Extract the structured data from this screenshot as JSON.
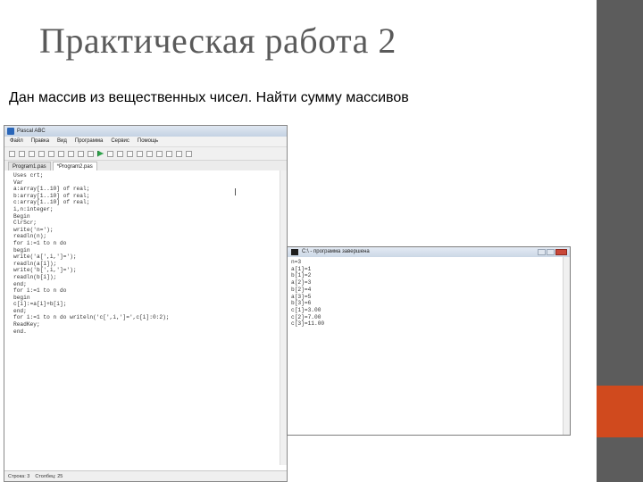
{
  "slide": {
    "title": "Практическая работа 2",
    "subtitle": "Дан массив из вещественных чисел. Найти сумму массивов"
  },
  "ide": {
    "window_title": "Pascal ABC",
    "menu": [
      "Файл",
      "Правка",
      "Вид",
      "Программа",
      "Сервис",
      "Помощь"
    ],
    "tabs": [
      "Program1.pas",
      "*Program2.pas"
    ],
    "code_lines": [
      "Uses crt;",
      "Var",
      "a:array[1..10] of real;",
      "b:array[1..10] of real;",
      "c:array[1..10] of real;",
      "i,n:integer;",
      "Begin",
      "ClrScr;",
      "write('n=');",
      "readln(n);",
      "for i:=1 to n do",
      "begin",
      "write('a[',i,']=');",
      "readln(a[i]);",
      "write('b[',i,']=');",
      "readln(b[i]);",
      "end;",
      "for i:=1 to n do",
      "begin",
      "c[i]:=a[i]+b[i];",
      "end;",
      "for i:=1 to n do writeln('c[',i,']=',c[i]:0:2);",
      "ReadKey;",
      "end."
    ],
    "status": [
      "Строка: 3",
      "Столбец: 25"
    ]
  },
  "console": {
    "window_title": "C:\\ - программа завершена",
    "lines": [
      "n=3",
      "a[1]=1",
      "b[1]=2",
      "a[2]=3",
      "b[2]=4",
      "a[3]=5",
      "b[3]=6",
      "c[1]=3.00",
      "c[2]=7.00",
      "c[3]=11.00"
    ]
  },
  "colors": {
    "right_bar": "#5c5c5c",
    "accent": "#d04a1e",
    "title_text": "#5a5a5a"
  }
}
